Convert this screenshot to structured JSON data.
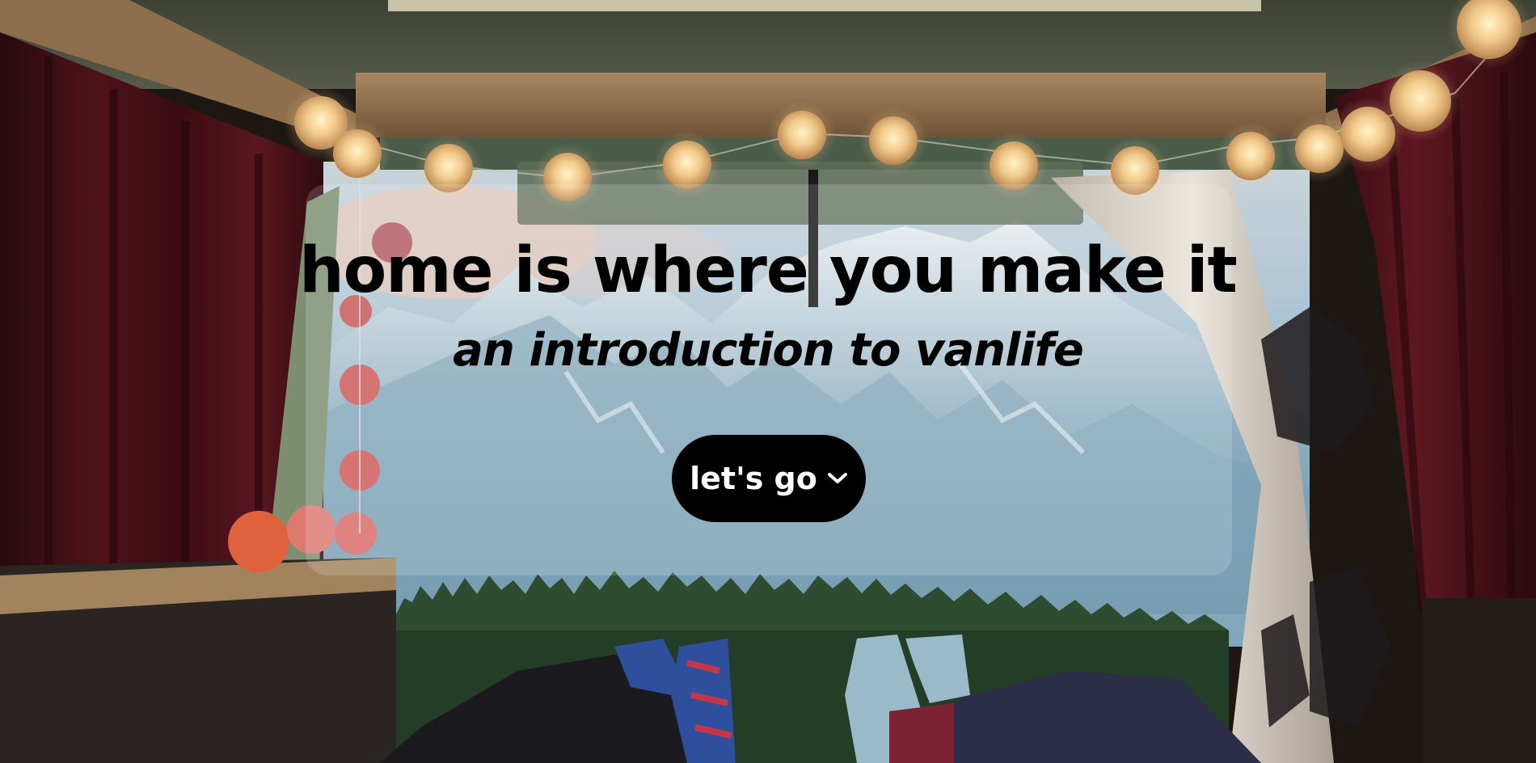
{
  "hero": {
    "headline": "home is where you make it",
    "subheadline": "an introduction to vanlife",
    "cta_label": "let's go",
    "cta_icon": "chevron-down-icon"
  },
  "colors": {
    "text": "#000000",
    "button_bg": "#000000",
    "button_text": "#ffffff",
    "curtain": "#4a1018",
    "sky": "#9fc3d6",
    "forest": "#2d4a2a"
  }
}
